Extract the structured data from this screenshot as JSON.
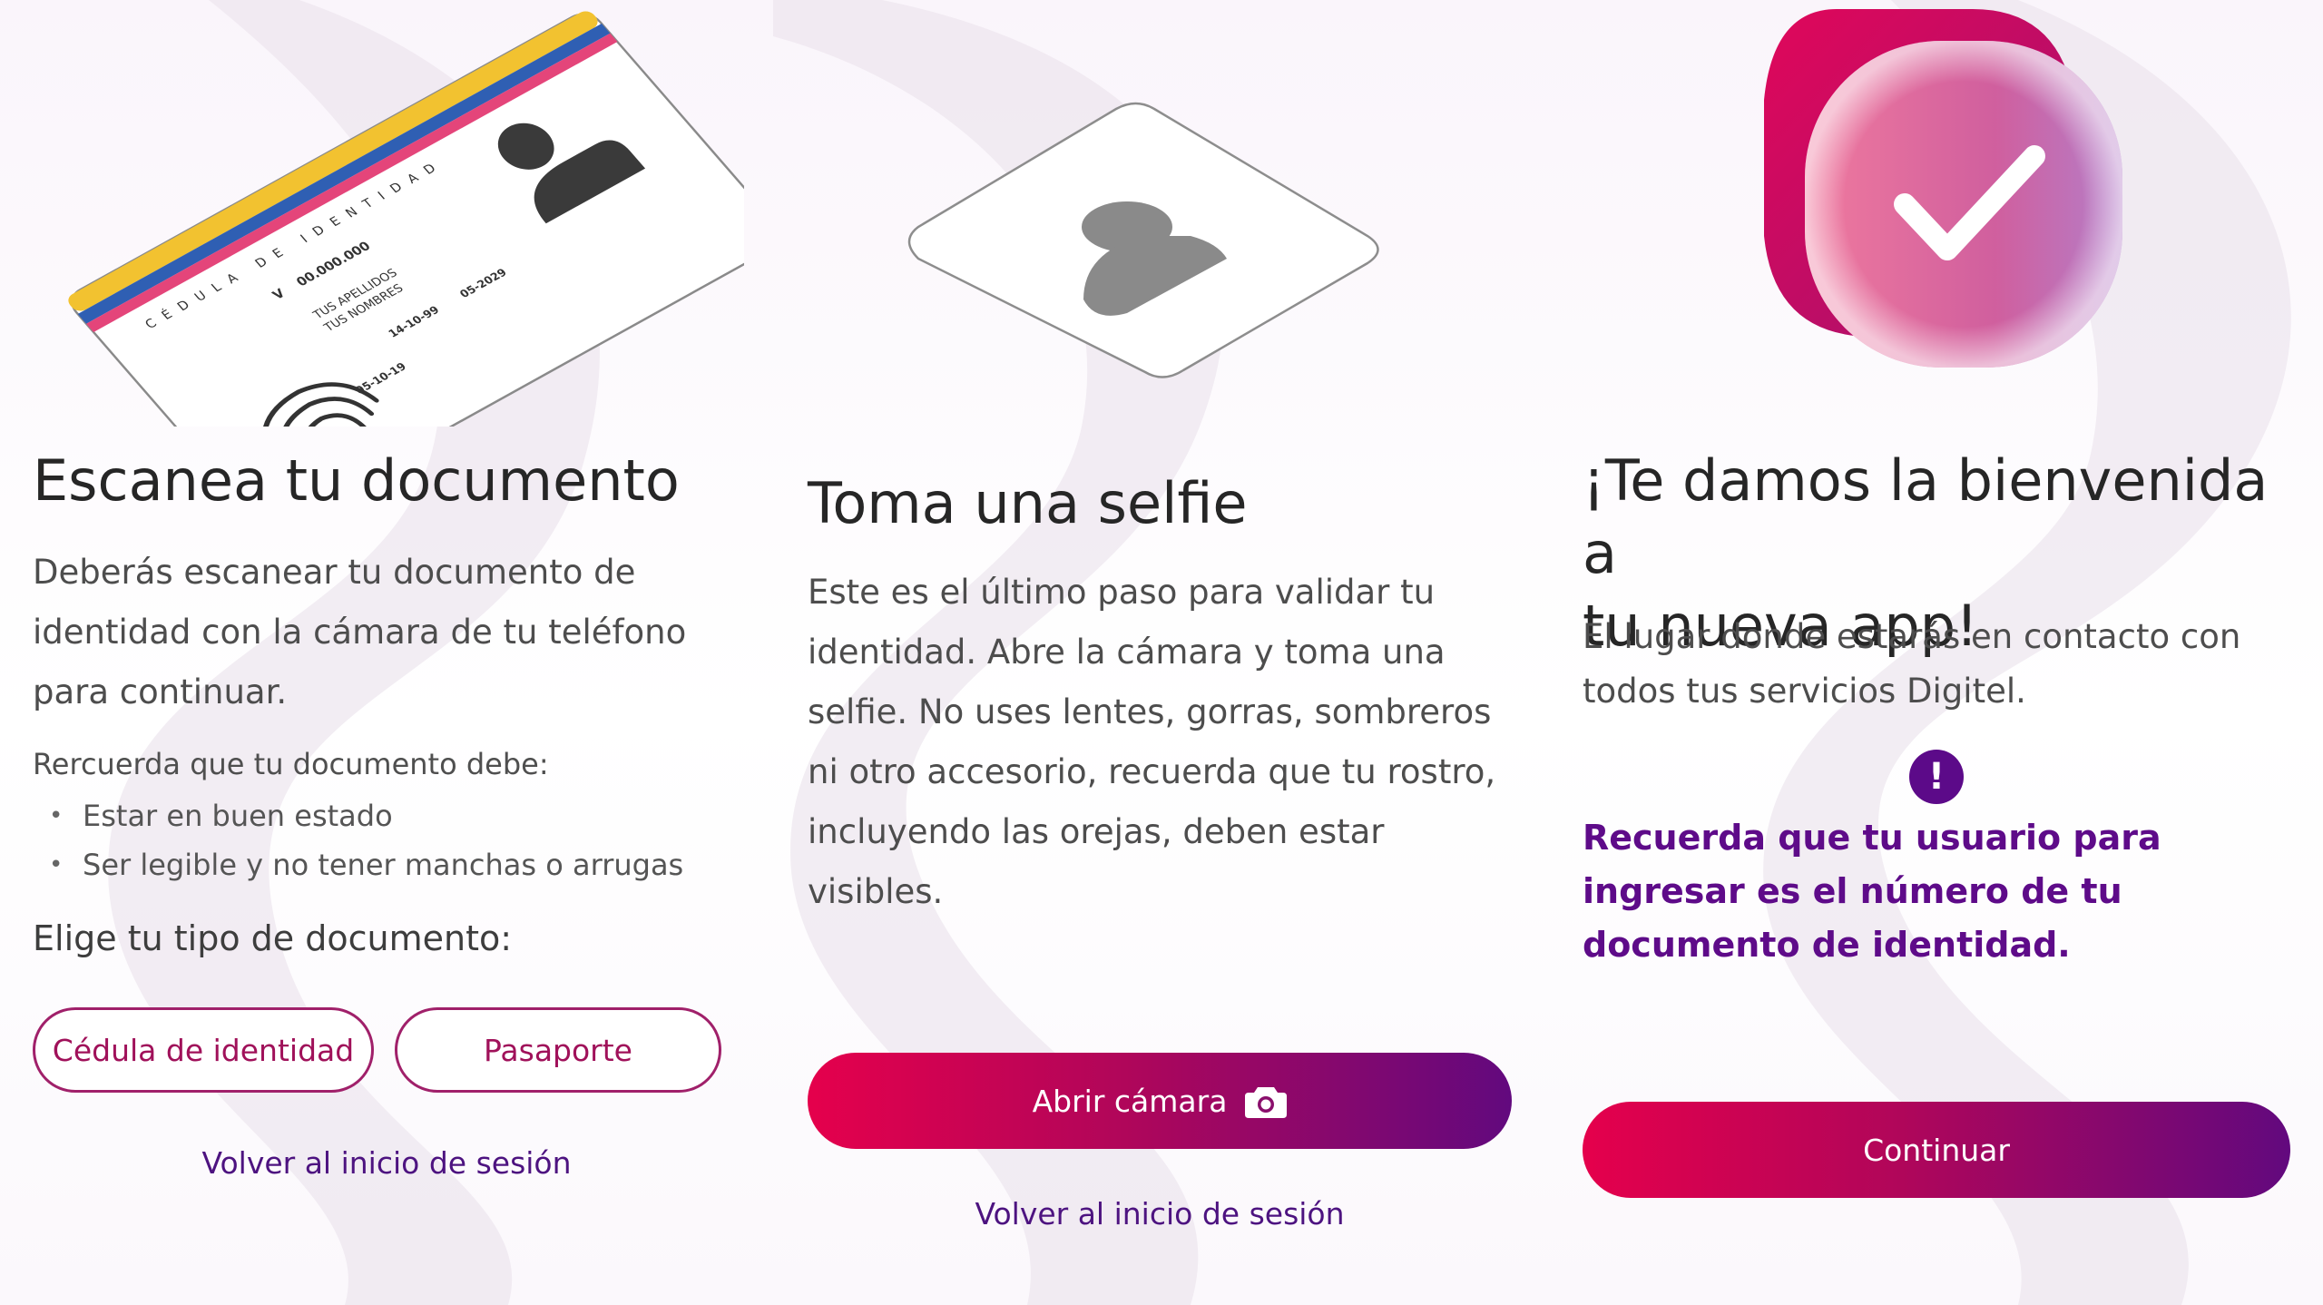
{
  "panel_document": {
    "card": {
      "title": "CÉDULA DE IDENTIDAD",
      "number_prefix": "V",
      "number": "00.000.000",
      "surnames": "TUS APELLIDOS",
      "names": "TUS NOMBRES",
      "birth_date": "14-10-99",
      "issue_date": "05-10-19",
      "expiry_date": "05-2029"
    },
    "title": "Escanea tu documento",
    "description": "Deberás escanear tu documento de identidad con la cámara de tu teléfono para continuar.",
    "reminder_intro": "Rercuerda que tu documento debe:",
    "requirements": [
      "Estar en buen estado",
      "Ser legible y no tener manchas o arrugas"
    ],
    "choose_label": "Elige tu tipo de documento:",
    "id_card_button": "Cédula de identidad",
    "passport_button": "Pasaporte",
    "back_link": "Volver al inicio de sesión"
  },
  "panel_selfie": {
    "title": "Toma una selfie",
    "description": "Este es el último paso para validar tu identidad. Abre la cámara y toma una selfie. No uses lentes, gorras, sombreros ni otro accesorio, recuerda que tu rostro, incluyendo las orejas, deben estar visibles.",
    "open_camera_button": "Abrir cámara",
    "camera_icon": "camera-icon",
    "back_link": "Volver al inicio de sesión"
  },
  "panel_welcome": {
    "title_line1": "¡Te damos la bienvenida a",
    "title_line2": "tu nueva app!",
    "description": "El lugar donde estarás en contacto con todos tus servicios Digitel.",
    "alert_icon": "exclamation-icon",
    "notice": "Recuerda que tu usuario para ingresar es el número de tu documento de identidad.",
    "continue_button": "Continuar"
  },
  "colors": {
    "brand_red": "#e5004c",
    "brand_purple": "#62097e",
    "link_purple": "#4d1380",
    "notice_purple": "#5e0b89"
  }
}
